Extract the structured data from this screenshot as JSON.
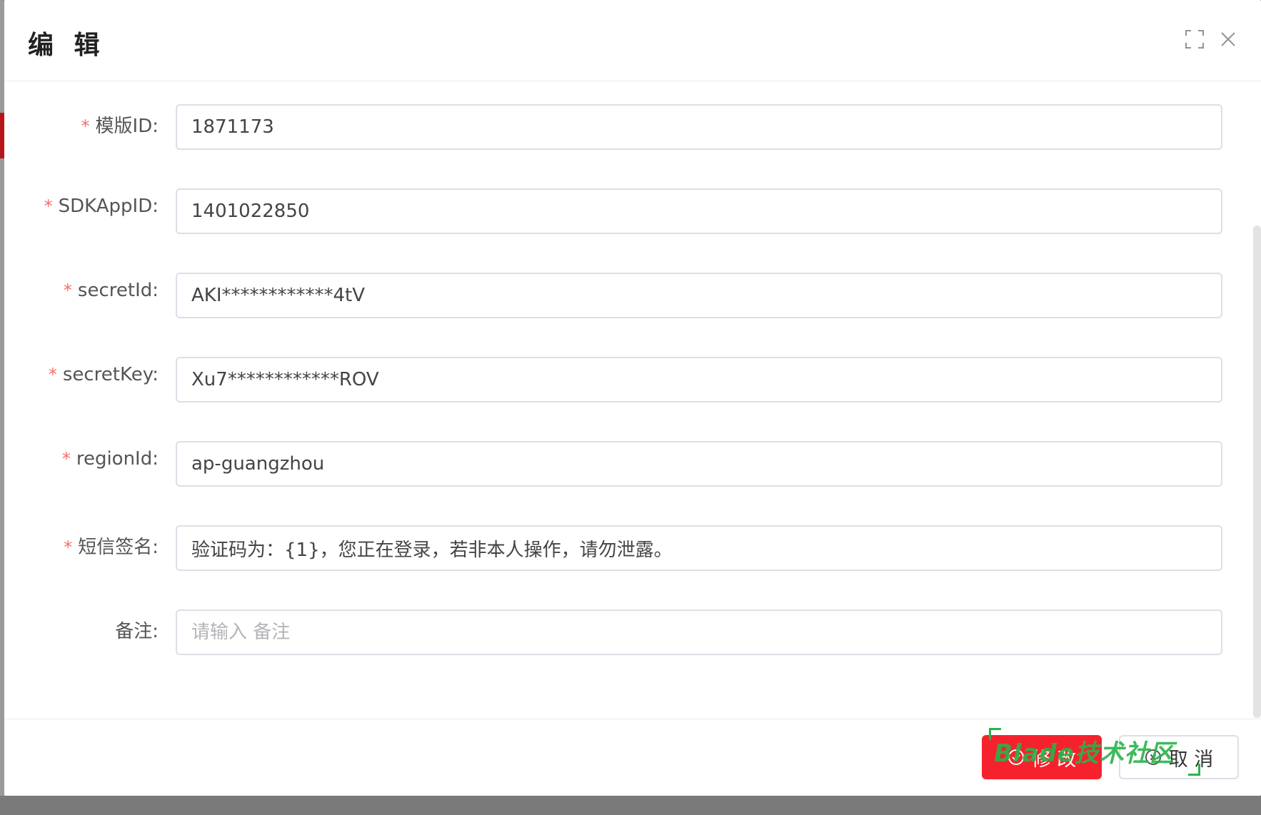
{
  "dialog": {
    "title": "编 辑"
  },
  "form": {
    "fields": [
      {
        "label": "模版ID:",
        "required": true,
        "value": "1871173",
        "placeholder": ""
      },
      {
        "label": "SDKAppID:",
        "required": true,
        "value": "1401022850",
        "placeholder": ""
      },
      {
        "label": "secretId:",
        "required": true,
        "value": "AKI************4tV",
        "placeholder": ""
      },
      {
        "label": "secretKey:",
        "required": true,
        "value": "Xu7************ROV",
        "placeholder": ""
      },
      {
        "label": "regionId:",
        "required": true,
        "value": "ap-guangzhou",
        "placeholder": ""
      },
      {
        "label": "短信签名:",
        "required": true,
        "value": "验证码为：{1}，您正在登录，若非本人操作，请勿泄露。",
        "placeholder": ""
      },
      {
        "label": "备注:",
        "required": false,
        "value": "",
        "placeholder": "请输入 备注"
      }
    ],
    "required_mark": "*"
  },
  "footer": {
    "submit_label": "修 改",
    "cancel_label": "取 消"
  },
  "watermark": {
    "text": "Blade技术社区"
  },
  "colors": {
    "primary": "#f5222d",
    "required": "#f56c6c",
    "watermark": "#29b34a"
  },
  "icons": {
    "fullscreen": "fullscreen-icon",
    "close": "close-icon",
    "submit": "check-circle-icon",
    "cancel": "circle-close-icon"
  }
}
